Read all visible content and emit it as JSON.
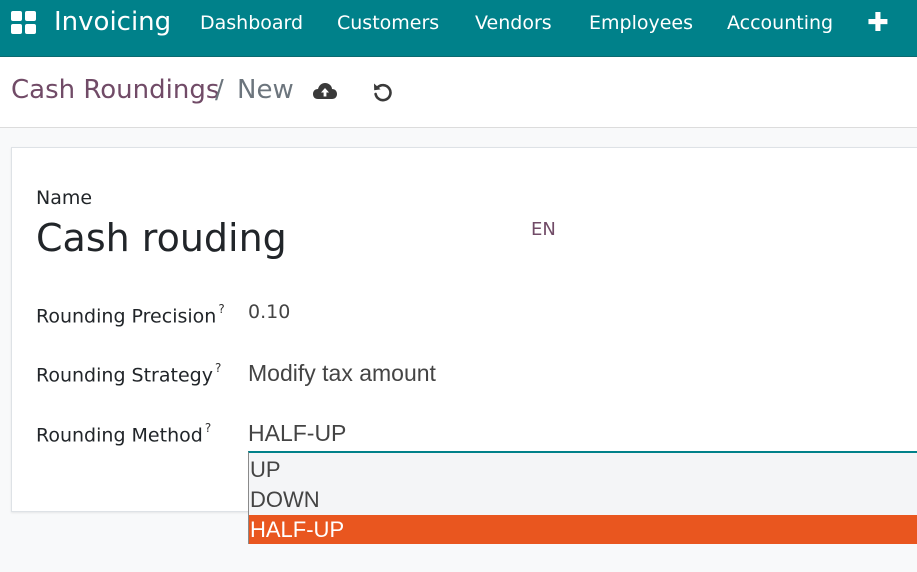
{
  "navbar": {
    "app_name": "Invoicing",
    "menu": [
      "Dashboard",
      "Customers",
      "Vendors",
      "Employees",
      "Accounting"
    ],
    "more_icon": "plus-icon",
    "apps_icon": "apps-grid-icon"
  },
  "breadcrumb": {
    "parent": "Cash Roundings",
    "separator": "/",
    "current": "New",
    "save_icon": "cloud-upload-icon",
    "discard_icon": "undo-icon"
  },
  "form": {
    "name_label": "Name",
    "name_value": "Cash rouding",
    "lang_badge": "EN",
    "fields": [
      {
        "label": "Rounding Precision",
        "help": "?",
        "value": "0.10"
      },
      {
        "label": "Rounding Strategy",
        "help": "?",
        "value": "Modify tax amount"
      },
      {
        "label": "Rounding Method",
        "help": "?",
        "value": "HALF-UP"
      }
    ]
  },
  "dropdown": {
    "options": [
      "UP",
      "DOWN",
      "HALF-UP"
    ],
    "selected": "HALF-UP"
  },
  "colors": {
    "navbar": "#00818a",
    "breadcrumb_link": "#714b67",
    "selected_option": "#e9561f"
  }
}
